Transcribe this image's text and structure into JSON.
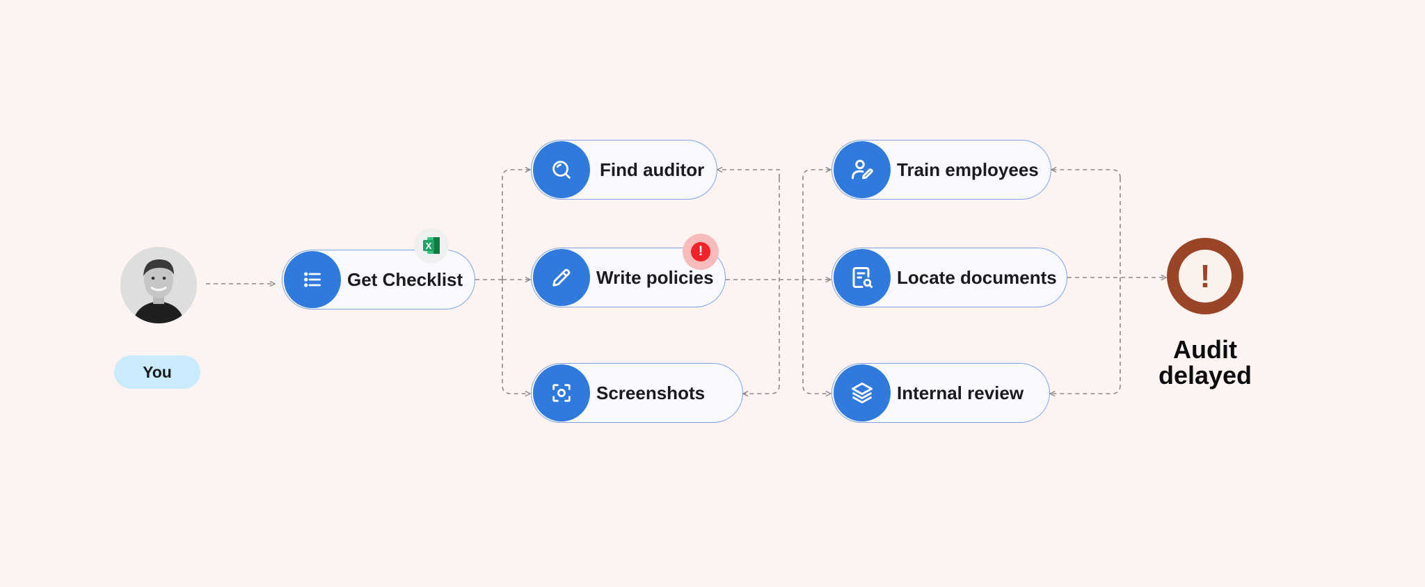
{
  "user": {
    "label": "You"
  },
  "nodes": {
    "get_checklist": {
      "label": "Get Checklist",
      "icon": "list-icon"
    },
    "find_auditor": {
      "label": "Find auditor",
      "icon": "search-icon"
    },
    "write_policies": {
      "label": "Write policies",
      "icon": "pencil-icon"
    },
    "screenshots": {
      "label": "Screenshots",
      "icon": "camera-focus-icon"
    },
    "train_employees": {
      "label": "Train employees",
      "icon": "user-edit-icon"
    },
    "locate_documents": {
      "label": "Locate documents",
      "icon": "document-search-icon"
    },
    "internal_review": {
      "label": "Internal review",
      "icon": "layers-icon"
    }
  },
  "badges": {
    "excel": {
      "icon": "excel-icon",
      "text": "X",
      "color": "#21a366"
    },
    "alert": {
      "icon": "alert-icon",
      "text": "!",
      "color": "#ee2228"
    }
  },
  "outcome": {
    "line1": "Audit",
    "line2": "delayed",
    "mark": "!",
    "color": "#9a4428"
  },
  "colors": {
    "background": "#fdf4f2",
    "accent": "#2f7adc",
    "node_border": "#7da2e3",
    "you_pill": "#c9ebfb",
    "connector": "#8a8a8a"
  }
}
